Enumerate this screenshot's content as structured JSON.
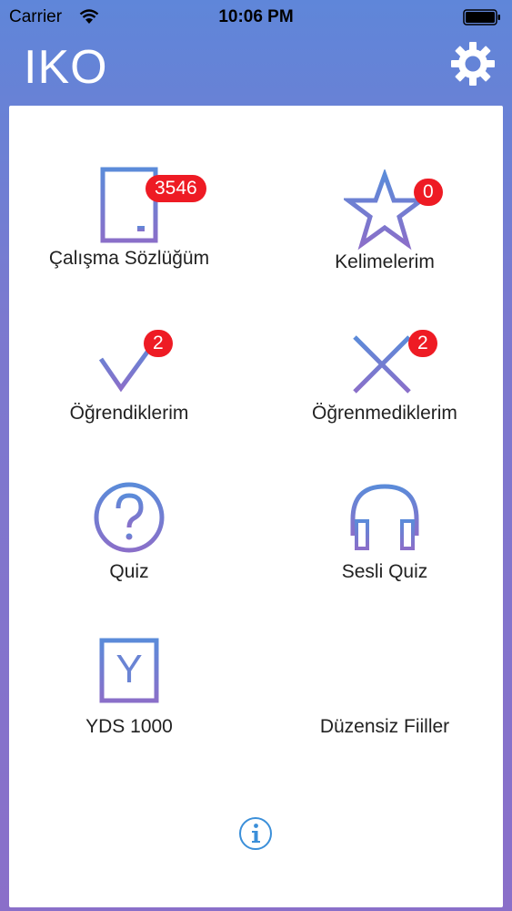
{
  "status_bar": {
    "carrier": "Carrier",
    "time": "10:06 PM"
  },
  "nav": {
    "title": "IKO"
  },
  "menu": {
    "items": [
      {
        "label": "Çalışma Sözlüğüm",
        "badge": "3546",
        "icon": "document-icon"
      },
      {
        "label": "Kelimelerim",
        "badge": "0",
        "icon": "star-icon"
      },
      {
        "label": "Öğrendiklerim",
        "badge": "2",
        "icon": "checkmark-icon"
      },
      {
        "label": "Öğrenmediklerim",
        "badge": "2",
        "icon": "x-icon"
      },
      {
        "label": "Quiz",
        "icon": "question-circle-icon"
      },
      {
        "label": "Sesli Quiz",
        "icon": "headphones-icon"
      },
      {
        "label": "YDS 1000",
        "icon_letter": "Y",
        "icon": "y-box-icon"
      },
      {
        "label": "Düzensiz Fiiller",
        "icon": "list-lines-icon"
      }
    ]
  },
  "colors": {
    "icon_top": "#5b8bd9",
    "icon_bottom": "#8a6fc9",
    "badge": "#ee1b24",
    "info": "#3b8fd9"
  }
}
